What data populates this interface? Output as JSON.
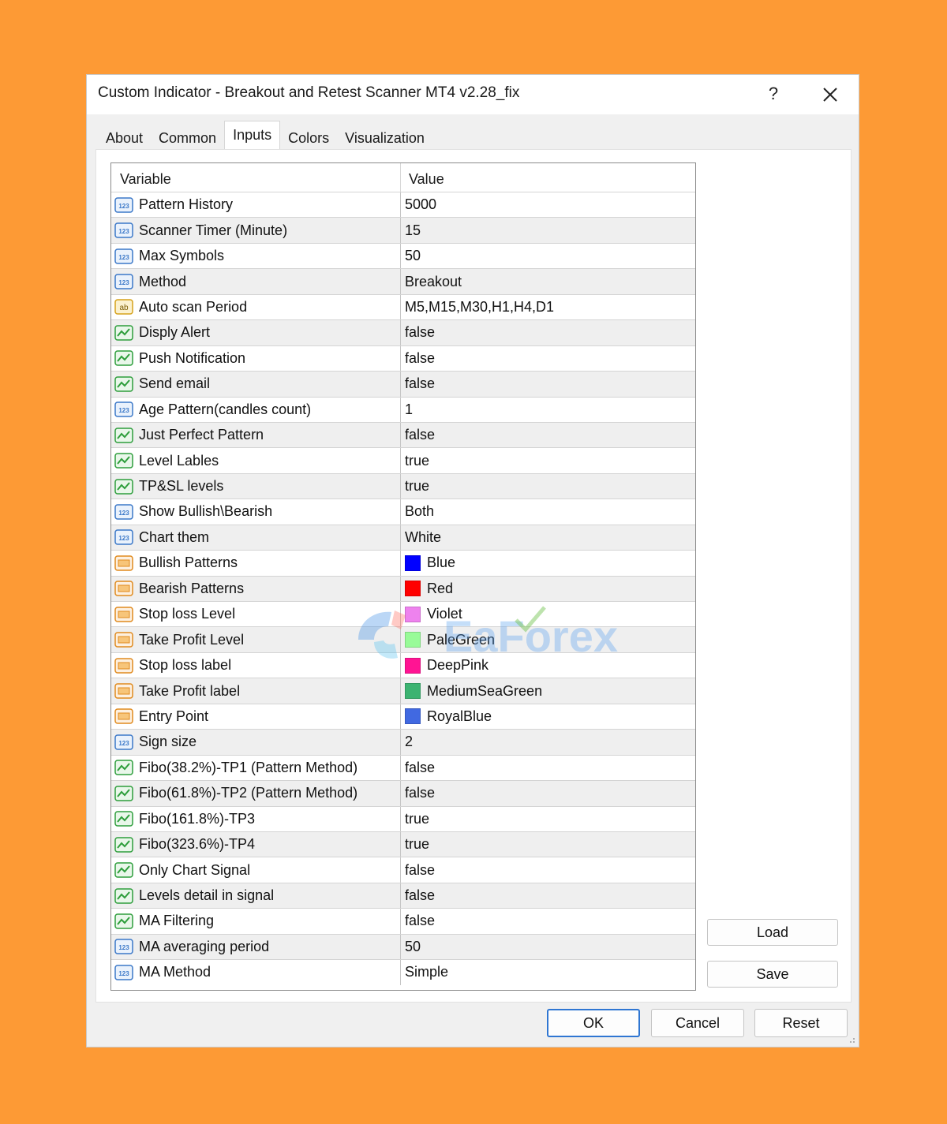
{
  "window": {
    "title": "Custom Indicator - Breakout and Retest Scanner MT4 v2.28_fix",
    "help_label": "?"
  },
  "tabs": [
    {
      "label": "About"
    },
    {
      "label": "Common"
    },
    {
      "label": "Inputs",
      "active": true
    },
    {
      "label": "Colors"
    },
    {
      "label": "Visualization"
    }
  ],
  "grid": {
    "headers": {
      "variable": "Variable",
      "value": "Value"
    },
    "rows": [
      {
        "type": "int",
        "variable": "Pattern History",
        "value": "5000"
      },
      {
        "type": "int",
        "variable": "Scanner Timer (Minute)",
        "value": "15"
      },
      {
        "type": "int",
        "variable": "Max Symbols",
        "value": "50"
      },
      {
        "type": "int",
        "variable": "Method",
        "value": "Breakout"
      },
      {
        "type": "str",
        "variable": "Auto scan Period",
        "value": "M5,M15,M30,H1,H4,D1"
      },
      {
        "type": "bool",
        "variable": "Disply Alert",
        "value": "false"
      },
      {
        "type": "bool",
        "variable": "Push Notification",
        "value": "false"
      },
      {
        "type": "bool",
        "variable": "Send email",
        "value": "false"
      },
      {
        "type": "int",
        "variable": "Age Pattern(candles count)",
        "value": "1"
      },
      {
        "type": "bool",
        "variable": "Just Perfect Pattern",
        "value": "false"
      },
      {
        "type": "bool",
        "variable": "Level Lables",
        "value": "true"
      },
      {
        "type": "bool",
        "variable": "TP&SL levels",
        "value": "true"
      },
      {
        "type": "int",
        "variable": "Show Bullish\\Bearish",
        "value": "Both"
      },
      {
        "type": "int",
        "variable": "Chart them",
        "value": "White"
      },
      {
        "type": "color",
        "variable": "Bullish Patterns",
        "value": "Blue",
        "color": "#0000ff"
      },
      {
        "type": "color",
        "variable": "Bearish Patterns",
        "value": "Red",
        "color": "#ff0000"
      },
      {
        "type": "color",
        "variable": "Stop loss Level",
        "value": "Violet",
        "color": "#ee82ee"
      },
      {
        "type": "color",
        "variable": "Take Profit Level",
        "value": "PaleGreen",
        "color": "#98fb98"
      },
      {
        "type": "color",
        "variable": "Stop loss label",
        "value": "DeepPink",
        "color": "#ff1493"
      },
      {
        "type": "color",
        "variable": "Take Profit label",
        "value": "MediumSeaGreen",
        "color": "#3cb371"
      },
      {
        "type": "color",
        "variable": "Entry Point",
        "value": "RoyalBlue",
        "color": "#4169e1"
      },
      {
        "type": "int",
        "variable": "Sign size",
        "value": "2"
      },
      {
        "type": "bool",
        "variable": "Fibo(38.2%)-TP1 (Pattern Method)",
        "value": "false"
      },
      {
        "type": "bool",
        "variable": "Fibo(61.8%)-TP2 (Pattern Method)",
        "value": "false"
      },
      {
        "type": "bool",
        "variable": "Fibo(161.8%)-TP3",
        "value": "true"
      },
      {
        "type": "bool",
        "variable": "Fibo(323.6%)-TP4",
        "value": "true"
      },
      {
        "type": "bool",
        "variable": "Only Chart Signal",
        "value": "false"
      },
      {
        "type": "bool",
        "variable": "Levels detail in signal",
        "value": "false"
      },
      {
        "type": "bool",
        "variable": "MA Filtering",
        "value": "false"
      },
      {
        "type": "int",
        "variable": "MA averaging period",
        "value": "50"
      },
      {
        "type": "int",
        "variable": "MA Method",
        "value": "Simple"
      }
    ]
  },
  "side_buttons": {
    "load": "Load",
    "save": "Save"
  },
  "footer": {
    "ok": "OK",
    "cancel": "Cancel",
    "reset": "Reset"
  },
  "watermark": {
    "text": "EaForex"
  },
  "colors": {
    "background": "#fd9a35",
    "primary_button_border": "#2f76d2",
    "icon_int": "#3b78c8",
    "icon_str": "#d6a21c",
    "icon_bool": "#2e9e3c",
    "icon_color": "#e08a1e"
  }
}
